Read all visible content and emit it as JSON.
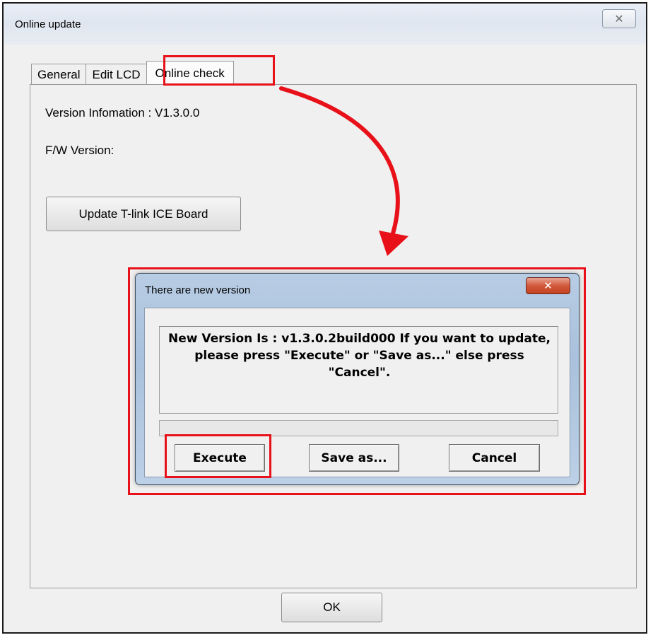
{
  "window": {
    "title": "Online update",
    "close_glyph": "✕"
  },
  "tabs": [
    {
      "label": "General"
    },
    {
      "label": "Edit LCD"
    },
    {
      "label": "Online check"
    }
  ],
  "panel": {
    "version_info": "Version Infomation : V1.3.0.0",
    "fw_version": "F/W Version:",
    "update_button": "Update T-link ICE Board"
  },
  "footer": {
    "ok_label": "OK"
  },
  "dialog": {
    "title": "There are new version",
    "close_glyph": "✕",
    "message": "New Version Is : v1.3.0.2build000   If you want to update, please press \"Execute\" or \"Save as...\" else press \"Cancel\".",
    "execute_label": "Execute",
    "save_as_label": "Save as...",
    "cancel_label": "Cancel"
  },
  "annotation_color": "#e8111a"
}
